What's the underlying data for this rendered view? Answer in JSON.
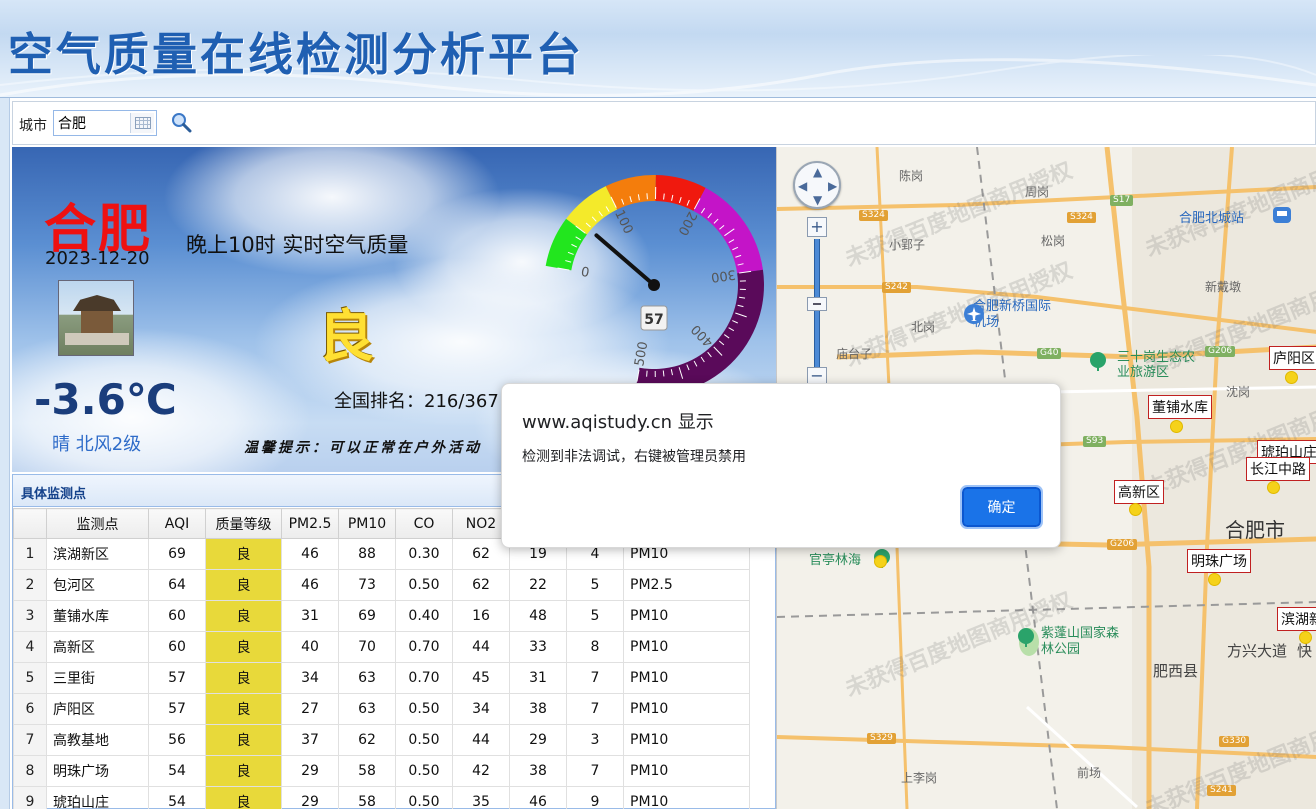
{
  "header": {
    "title": "空气质量在线检测分析平台"
  },
  "toolbar": {
    "city_label": "城市",
    "city_value": "合肥"
  },
  "summary": {
    "city": "合肥",
    "date": "2023-12-20",
    "headline": "晚上10时 实时空气质量",
    "grade": "良",
    "temperature": "-3.6℃",
    "weather": "晴 北风2级",
    "rank": "全国排名：216/367",
    "tip": "温馨提示：可以正常在户外活动"
  },
  "gauge": {
    "aqi": 57,
    "aqi_label": "57",
    "scale_max": 500,
    "tick_labels": [
      "0",
      "100",
      "200",
      "300",
      "400",
      "500"
    ],
    "band_colors": [
      "#22e61e",
      "#f4ea2a",
      "#f47d0c",
      "#f0190e",
      "#c414c8",
      "#5a0a5a"
    ]
  },
  "stations": {
    "title": "具体监测点",
    "columns": [
      "",
      "监测点",
      "AQI",
      "质量等级",
      "PM2.5",
      "PM10",
      "CO",
      "NO2",
      "",
      "",
      ""
    ],
    "rows": [
      [
        "1",
        "滨湖新区",
        "69",
        "良",
        "46",
        "88",
        "0.30",
        "62",
        "19",
        "4",
        "PM10"
      ],
      [
        "2",
        "包河区",
        "64",
        "良",
        "46",
        "73",
        "0.50",
        "62",
        "22",
        "5",
        "PM2.5"
      ],
      [
        "3",
        "董铺水库",
        "60",
        "良",
        "31",
        "69",
        "0.40",
        "16",
        "48",
        "5",
        "PM10"
      ],
      [
        "4",
        "高新区",
        "60",
        "良",
        "40",
        "70",
        "0.70",
        "44",
        "33",
        "8",
        "PM10"
      ],
      [
        "5",
        "三里街",
        "57",
        "良",
        "34",
        "63",
        "0.70",
        "45",
        "31",
        "7",
        "PM10"
      ],
      [
        "6",
        "庐阳区",
        "57",
        "良",
        "27",
        "63",
        "0.50",
        "34",
        "38",
        "7",
        "PM10"
      ],
      [
        "7",
        "高教基地",
        "56",
        "良",
        "37",
        "62",
        "0.50",
        "44",
        "29",
        "3",
        "PM10"
      ],
      [
        "8",
        "明珠广场",
        "54",
        "良",
        "29",
        "58",
        "0.50",
        "42",
        "38",
        "7",
        "PM10"
      ],
      [
        "9",
        "琥珀山庄",
        "54",
        "良",
        "29",
        "58",
        "0.50",
        "35",
        "46",
        "9",
        "PM10"
      ]
    ],
    "grade_color": "#e8d93a"
  },
  "map": {
    "watermark": "未获得百度地图商用授权",
    "places": [
      "陈岗",
      "周岗",
      "小郢子",
      "松岗",
      "合肥北城站",
      "新戴墩",
      "合肥新桥国际机场",
      "北岗",
      "庙台子",
      "三十岗生态农业旅游区",
      "沈岗",
      "官亭林海",
      "合肥市",
      "紫蓬山国家森林公园",
      "肥西县",
      "方兴大道",
      "快",
      "上李岗",
      "前场"
    ],
    "roads": [
      "S324",
      "S324",
      "S17",
      "S242",
      "G40",
      "G206",
      "S93",
      "G206",
      "S329",
      "G330",
      "S241"
    ],
    "markers": [
      "庐阳区",
      "董铺水库",
      "琥珀山庄",
      "长江中路",
      "高新区",
      "明珠广场",
      "滨湖新区"
    ]
  },
  "dialog": {
    "title": "www.aqistudy.cn 显示",
    "message": "检测到非法调试，右键被管理员禁用",
    "ok_label": "确定"
  }
}
